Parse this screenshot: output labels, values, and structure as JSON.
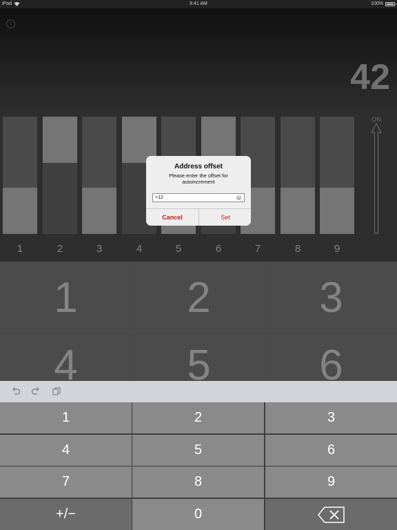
{
  "status_bar": {
    "device": "iPad",
    "time": "9:41 AM",
    "battery": "100%"
  },
  "display": {
    "value": "42"
  },
  "switches": [
    {
      "label": "1",
      "state": "off"
    },
    {
      "label": "2",
      "state": "on"
    },
    {
      "label": "3",
      "state": "off"
    },
    {
      "label": "4",
      "state": "on"
    },
    {
      "label": "5",
      "state": "off"
    },
    {
      "label": "6",
      "state": "on"
    },
    {
      "label": "7",
      "state": "off"
    },
    {
      "label": "8",
      "state": "off"
    },
    {
      "label": "9",
      "state": "off"
    }
  ],
  "on_indicator": {
    "label": "ON"
  },
  "keypad": {
    "keys": [
      "1",
      "2",
      "3",
      "4",
      "5",
      "6"
    ]
  },
  "dialog": {
    "title": "Address offset",
    "message": "Please enter the offset for autoincrement",
    "input_value": "+12",
    "cancel_label": "Cancel",
    "set_label": "Set",
    "accent": "#c21a1a"
  },
  "keyboard_toolbar": {
    "icons": [
      "undo-icon",
      "redo-icon",
      "paste-icon"
    ]
  },
  "keyboard": {
    "keys": [
      "1",
      "2",
      "3",
      "4",
      "5",
      "6",
      "7",
      "8",
      "9",
      "+/−",
      "0"
    ],
    "backspace_icon": "backspace-icon"
  }
}
